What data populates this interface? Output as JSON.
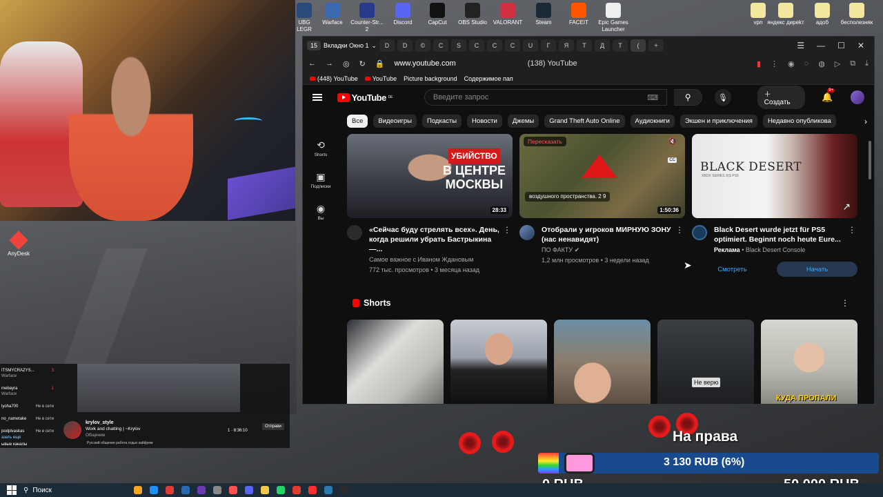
{
  "desktop_icons": [
    {
      "label": "UBG LEGR",
      "color": "#2a4a7a"
    },
    {
      "label": "Warface",
      "color": "#3a6ab0"
    },
    {
      "label": "Counter-Str... 2",
      "color": "#2a3a8a"
    },
    {
      "label": "Discord",
      "color": "#5865f2"
    },
    {
      "label": "CapCut",
      "color": "#111111"
    },
    {
      "label": "OBS Studio",
      "color": "#222222"
    },
    {
      "label": "VALORANT",
      "color": "#d03040"
    },
    {
      "label": "Steam",
      "color": "#1b2838"
    },
    {
      "label": "FACEIT",
      "color": "#ff5500"
    },
    {
      "label": "Epic Games Launcher",
      "color": "#eeeeee"
    },
    {
      "label": "vpn",
      "color": "#f3e7a0"
    },
    {
      "label": "яндекс диреkт",
      "color": "#f3e7a0"
    },
    {
      "label": "адоб",
      "color": "#f3e7a0"
    },
    {
      "label": "бесполезняк",
      "color": "#f3e7a0"
    }
  ],
  "anydesk": {
    "label": "AnyDesk"
  },
  "browser": {
    "workspace_count": "15",
    "workspace_label": "Вкладки Окно 1",
    "tabs": [
      "D",
      "D",
      "©",
      "С",
      "S",
      "С",
      "С",
      "С",
      "U",
      "Г",
      "Я",
      "Т",
      "Д",
      "Т",
      "("
    ],
    "url": "www.youtube.com",
    "page_title": "(138) YouTube",
    "bookmarks": [
      "(448) YouTube",
      "YouTube",
      "Picture background",
      "Содержимое пап"
    ]
  },
  "youtube": {
    "logo": "YouTube",
    "logo_region": "DE",
    "search_placeholder": "Введите запрос",
    "create_label": "Создать",
    "notif_badge": "9+",
    "chips": [
      "Все",
      "Видеоигры",
      "Подкасты",
      "Новости",
      "Джемы",
      "Grand Theft Auto Online",
      "Аудиокниги",
      "Экшен и приключения",
      "Недавно опубликова"
    ],
    "sidebar": [
      {
        "icon": "shorts-icon",
        "label": "Shorts"
      },
      {
        "icon": "subscriptions-icon",
        "label": "Подписки"
      },
      {
        "icon": "you-icon",
        "label": "Вы"
      }
    ],
    "videos": [
      {
        "thumb_text_top": "УБИЙСТВО",
        "thumb_text_mid": "В ЦЕНТРЕ",
        "thumb_text_bot": "МОСКВЫ",
        "duration": "28:33",
        "title": "«Сейчас буду стрелять всех». День, когда решили убрать Бастрыкина —...",
        "channel": "Самое важное с Иваном Ждановым",
        "stats": "772 тыс. просмотров • 3 месяца назад"
      },
      {
        "pill": "Пересказать",
        "caption": "воздушного пространства. 2 9",
        "duration": "1:50:36",
        "title": "Отобрали у игроков МИРНУЮ ЗОНУ (нас ненавидят)",
        "channel": "ПО ФАКТУ ✔",
        "stats": "1,2 млн просмотров • 3 недели назад"
      },
      {
        "thumb_brand": "BLACK DESERT",
        "thumb_sub": "XBOX SERIES X|S  PS5",
        "title": "Black Desert wurde jetzt für PS5 optimiert. Beginnt noch heute Eure...",
        "ad_label": "Реклама",
        "channel": "• Black Desert Console",
        "watch_label": "Смотреть",
        "start_label": "Начать"
      }
    ],
    "shorts_title": "Shorts",
    "shorts_overlays": {
      "s4": "Не верю",
      "s5": "КУДА ПРОПАЛИ"
    }
  },
  "chat": {
    "users": [
      {
        "name": "ITSMYCRAZYS...",
        "sub": "Warface",
        "status": "3"
      },
      {
        "name": "mebayra",
        "sub": "Warface",
        "status": "1"
      },
      {
        "name": "lyoha700",
        "sub": "",
        "status": "Не в сети"
      },
      {
        "name": "no_nametake",
        "sub": "",
        "status": "Не в сети"
      },
      {
        "name": "podplvaskas",
        "sub": "",
        "status": "Не в сети"
      }
    ],
    "show_more": "азать еще",
    "channels_label": "ывые каналы",
    "streamer": "krylov_style",
    "stream_title": "Work and chatting | ~Krylov",
    "category": "Общение",
    "viewers": "1",
    "uptime": "8:36:10",
    "tags": "Русский  общение  работа  отдых  кайфуем",
    "send_label": "Отправи"
  },
  "donation": {
    "goal_label": "На права",
    "amount": "3 130 RUB (6%)",
    "progress_pct": 6,
    "min": "0 RUB",
    "max": "50 000 RUB"
  },
  "taskbar": {
    "search": "Поиск",
    "apps": [
      "#f5a623",
      "#1e90ff",
      "#e03c31",
      "#2a6ab0",
      "#6a3ab0",
      "#888888",
      "#ff5050",
      "#5865f2",
      "#f3c94a",
      "#25d366",
      "#e03c31",
      "#ff3030",
      "#2b7bb0",
      "#2a2a2a"
    ]
  },
  "colors": {
    "yt_red": "#ff0000",
    "chip_active": "#f1f1f1",
    "link_blue": "#3ea6ff"
  }
}
